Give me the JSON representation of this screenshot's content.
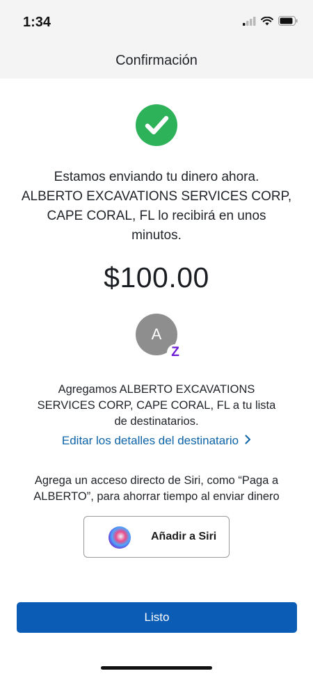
{
  "status_bar": {
    "time": "1:34",
    "icons": [
      "cellular-signal-icon",
      "wifi-icon",
      "battery-icon"
    ]
  },
  "nav": {
    "title": "Confirmación"
  },
  "confirmation": {
    "icon": "check-circle-icon",
    "message_lines": [
      "Estamos enviando tu dinero ahora.",
      "ALBERTO EXCAVATIONS SERVICES CORP,",
      "CAPE CORAL, FL lo recibirá en unos",
      "minutos."
    ],
    "amount": "$100.00"
  },
  "recipient": {
    "avatar_initial": "A",
    "badge": "Z",
    "added_lines": [
      "Agregamos ALBERTO EXCAVATIONS",
      "SERVICES CORP, CAPE CORAL, FL a tu lista",
      "de destinatarios."
    ],
    "edit_link": "Editar los detalles del destinatario"
  },
  "siri": {
    "hint_lines": [
      "Agrega un acceso directo de Siri, como “Paga a",
      "ALBERTO”, para ahorrar tiempo al enviar dinero"
    ],
    "button_label": "Añadir a Siri"
  },
  "actions": {
    "done_label": "Listo"
  },
  "colors": {
    "success": "#2db25a",
    "link": "#0d63a8",
    "primary_button": "#0b5cb5",
    "zelle": "#6d1ed4"
  }
}
